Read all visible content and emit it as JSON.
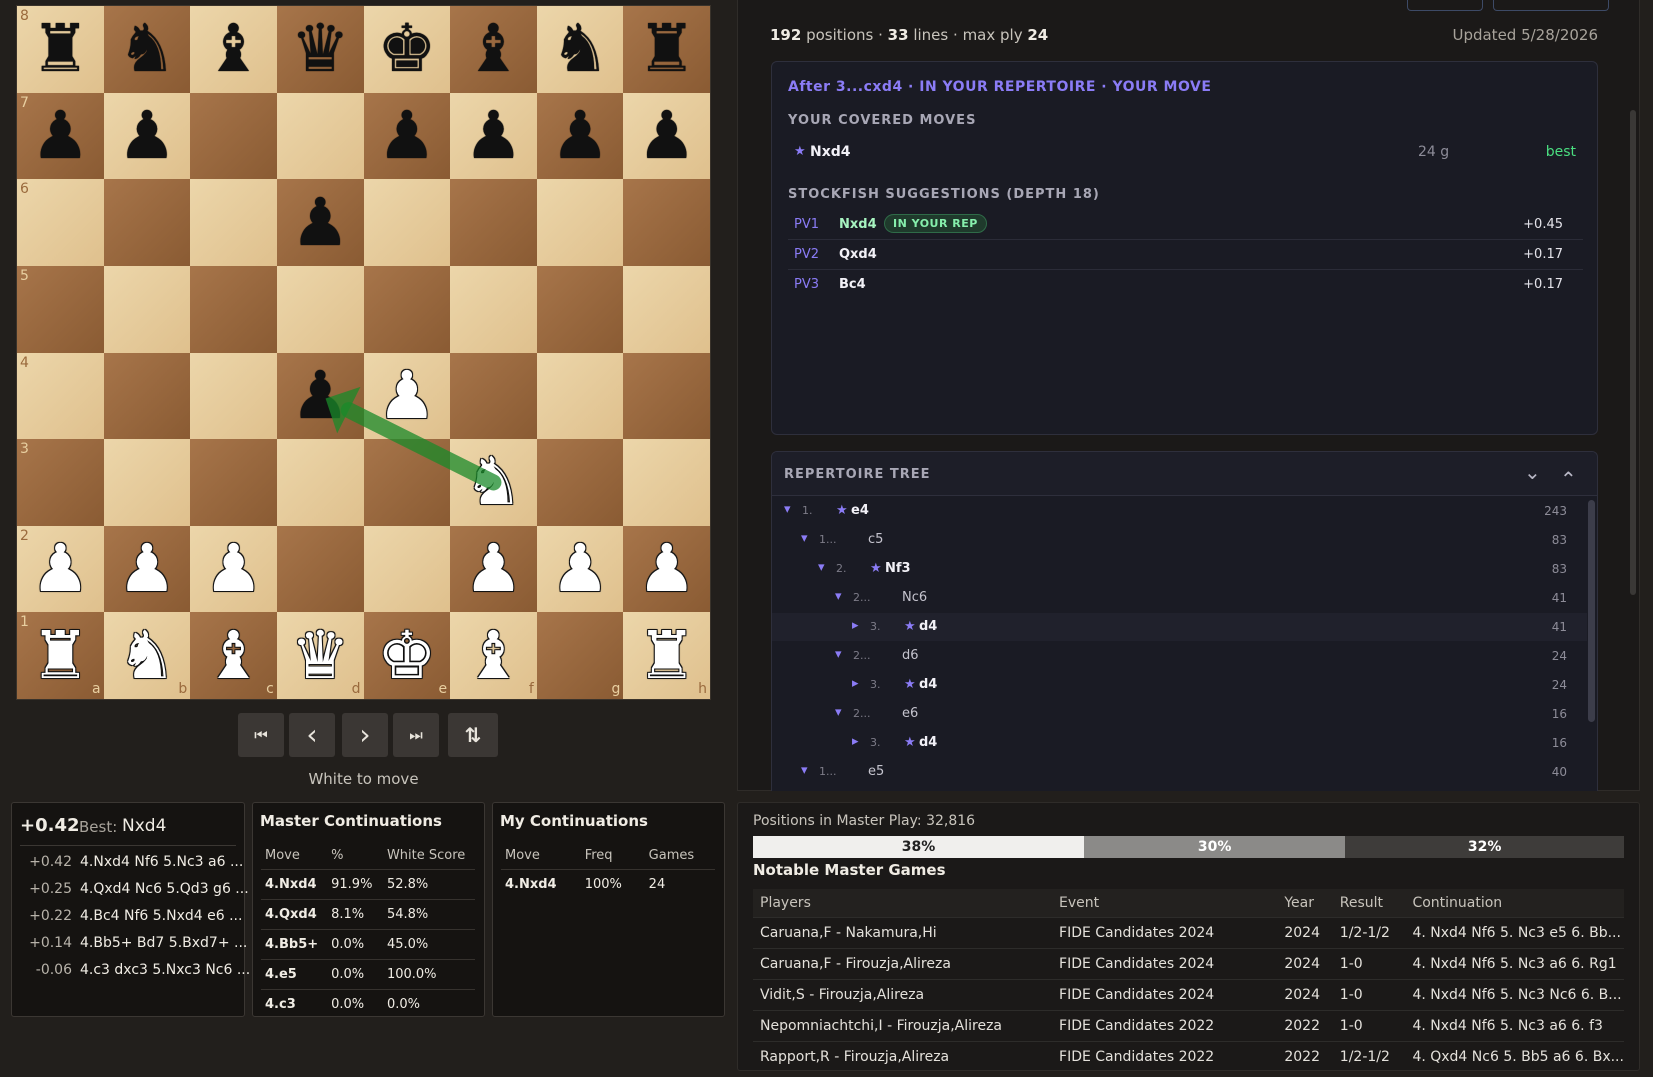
{
  "board": {
    "ranks": [
      "8",
      "7",
      "6",
      "5",
      "4",
      "3",
      "2",
      "1"
    ],
    "files": [
      "a",
      "b",
      "c",
      "d",
      "e",
      "f",
      "g",
      "h"
    ],
    "position": [
      [
        "br",
        "bn",
        "bb",
        "bq",
        "bk",
        "bb",
        "bn",
        "br"
      ],
      [
        "bp",
        "bp",
        "",
        "",
        "bp",
        "bp",
        "bp",
        "bp"
      ],
      [
        "",
        "",
        "",
        "bp",
        "",
        "",
        "",
        ""
      ],
      [
        "",
        "",
        "",
        "",
        "",
        "",
        "",
        ""
      ],
      [
        "",
        "",
        "",
        "bp",
        "wp",
        "",
        "",
        ""
      ],
      [
        "",
        "",
        "",
        "",
        "",
        "wn",
        "",
        ""
      ],
      [
        "wp",
        "wp",
        "wp",
        "",
        "",
        "wp",
        "wp",
        "wp"
      ],
      [
        "wr",
        "wn",
        "wb",
        "wq",
        "wk",
        "wb",
        "",
        "wr"
      ]
    ],
    "arrow": {
      "from": "f3",
      "to": "d4",
      "color": "#1a8a2a"
    }
  },
  "controls": {
    "first": "⏮",
    "prev": "‹",
    "next": "›",
    "last": "⏭",
    "flip": "⇅",
    "status": "White to move"
  },
  "engine": {
    "eval": "+0.42",
    "best_label": "Best:",
    "best_move": "Nxd4",
    "lines": [
      {
        "score": "+0.42",
        "line": "4.Nxd4 Nf6 5.Nc3 a6 ..."
      },
      {
        "score": "+0.25",
        "line": "4.Qxd4 Nc6 5.Qd3 g6 ..."
      },
      {
        "score": "+0.22",
        "line": "4.Bc4 Nf6 5.Nxd4 e6 ..."
      },
      {
        "score": "+0.14",
        "line": "4.Bb5+ Bd7 5.Bxd7+ ..."
      },
      {
        "score": "-0.06",
        "line": "4.c3 dxc3 5.Nxc3 Nc6 ..."
      }
    ]
  },
  "master_cont": {
    "title": "Master Continuations",
    "headers": [
      "Move",
      "%",
      "White Score"
    ],
    "rows": [
      [
        "4.Nxd4",
        "91.9%",
        "52.8%"
      ],
      [
        "4.Qxd4",
        "8.1%",
        "54.8%"
      ],
      [
        "4.Bb5+",
        "0.0%",
        "45.0%"
      ],
      [
        "4.e5",
        "0.0%",
        "100.0%"
      ],
      [
        "4.c3",
        "0.0%",
        "0.0%"
      ]
    ]
  },
  "my_cont": {
    "title": "My Continuations",
    "headers": [
      "Move",
      "Freq",
      "Games"
    ],
    "rows": [
      [
        "4.Nxd4",
        "100%",
        "24"
      ]
    ]
  },
  "stats": {
    "positions": "192",
    "positions_label": "positions",
    "lines": "33",
    "lines_label": "lines",
    "maxply_label": "max ply",
    "maxply": "24",
    "sep": "·",
    "updated": "Updated 5/28/2026"
  },
  "analysis": {
    "title": "After 3...cxd4 · IN YOUR REPERTOIRE · YOUR MOVE",
    "covered_header": "YOUR COVERED MOVES",
    "covered": [
      {
        "star": "★",
        "move": "Nxd4",
        "games": "24 g",
        "tag": "best"
      }
    ],
    "sf_header": "STOCKFISH SUGGESTIONS (DEPTH 18)",
    "pvs": [
      {
        "pv": "PV1",
        "move": "Nxd4",
        "badge": "IN YOUR REP",
        "score": "+0.45"
      },
      {
        "pv": "PV2",
        "move": "Qxd4",
        "badge": "",
        "score": "+0.17"
      },
      {
        "pv": "PV3",
        "move": "Bc4",
        "badge": "",
        "score": "+0.17"
      }
    ]
  },
  "tree": {
    "title": "REPERTOIRE TREE",
    "expand_all": "⌄",
    "collapse_all": "⌃",
    "rows": [
      {
        "num": "1.",
        "move": "e4",
        "star": true,
        "count": "243",
        "depth": 0,
        "open": true
      },
      {
        "num": "1...",
        "move": "c5",
        "star": false,
        "count": "83",
        "depth": 1,
        "open": true
      },
      {
        "num": "2.",
        "move": "Nf3",
        "star": true,
        "count": "83",
        "depth": 2,
        "open": true
      },
      {
        "num": "2...",
        "move": "Nc6",
        "star": false,
        "count": "41",
        "depth": 3,
        "open": true
      },
      {
        "num": "3.",
        "move": "d4",
        "star": true,
        "count": "41",
        "depth": 4,
        "open": false
      },
      {
        "num": "2...",
        "move": "d6",
        "star": false,
        "count": "24",
        "depth": 3,
        "open": true
      },
      {
        "num": "3.",
        "move": "d4",
        "star": true,
        "count": "24",
        "depth": 4,
        "open": false
      },
      {
        "num": "2...",
        "move": "e6",
        "star": false,
        "count": "16",
        "depth": 3,
        "open": true
      },
      {
        "num": "3.",
        "move": "d4",
        "star": true,
        "count": "16",
        "depth": 4,
        "open": false
      },
      {
        "num": "1...",
        "move": "e5",
        "star": false,
        "count": "40",
        "depth": 1,
        "open": true
      }
    ]
  },
  "master_play": {
    "label": "Positions in Master Play: 32,816",
    "white_pct": 38,
    "draw_pct": 30,
    "black_pct": 32,
    "white_label": "38%",
    "draw_label": "30%",
    "black_label": "32%"
  },
  "notable": {
    "title": "Notable Master Games",
    "headers": [
      "Players",
      "Event",
      "Year",
      "Result",
      "Continuation"
    ],
    "rows": [
      [
        "Caruana,F - Nakamura,Hi",
        "FIDE Candidates 2024",
        "2024",
        "1/2-1/2",
        "4. Nxd4 Nf6 5. Nc3 e5 6. Bb..."
      ],
      [
        "Caruana,F - Firouzja,Alireza",
        "FIDE Candidates 2024",
        "2024",
        "1-0",
        "4. Nxd4 Nf6 5. Nc3 a6 6. Rg1"
      ],
      [
        "Vidit,S - Firouzja,Alireza",
        "FIDE Candidates 2024",
        "2024",
        "1-0",
        "4. Nxd4 Nf6 5. Nc3 Nc6 6. B..."
      ],
      [
        "Nepomniachtchi,I - Firouzja,Alireza",
        "FIDE Candidates 2022",
        "2022",
        "1-0",
        "4. Nxd4 Nf6 5. Nc3 a6 6. f3"
      ],
      [
        "Rapport,R - Firouzja,Alireza",
        "FIDE Candidates 2022",
        "2022",
        "1/2-1/2",
        "4. Qxd4 Nc6 5. Bb5 a6 6. Bx..."
      ]
    ]
  },
  "colors": {
    "accent": "#8b7cf6",
    "best": "#4ade80",
    "badge_bg": "#1f3a2c",
    "badge_fg": "#86efac"
  }
}
